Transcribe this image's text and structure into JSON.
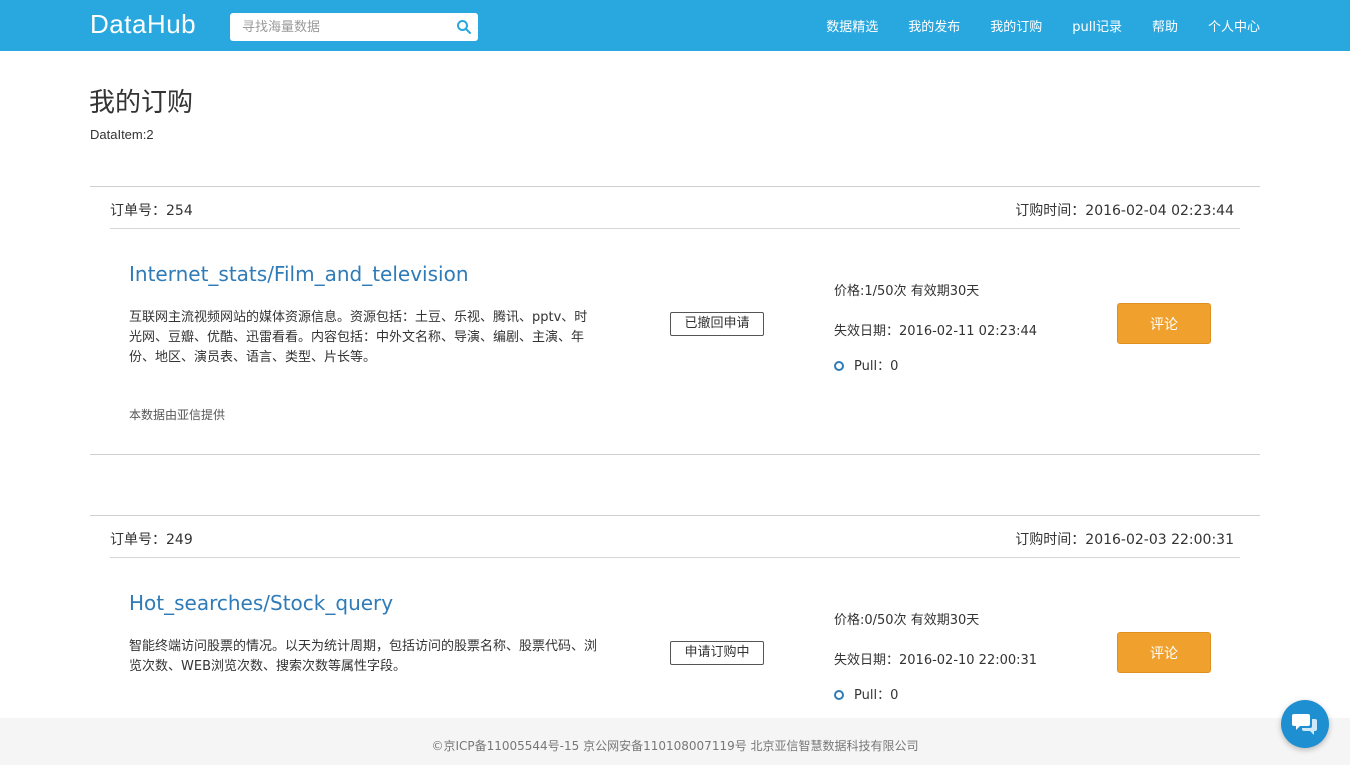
{
  "header": {
    "logo": "DataHub",
    "search_placeholder": "寻找海量数据",
    "nav": [
      "数据精选",
      "我的发布",
      "我的订购",
      "pull记录",
      "帮助",
      "个人中心"
    ]
  },
  "page": {
    "title": "我的订购",
    "item_count": "DataItem:2"
  },
  "orders": [
    {
      "order_no": "订单号：254",
      "order_time": "订购时间：2016-02-04 02:23:44",
      "title": "Internet_stats/Film_and_television",
      "description": "互联网主流视频网站的媒体资源信息。资源包括：土豆、乐视、腾讯、pptv、时光网、豆瓣、优酷、迅雷看看。内容包括：中外文名称、导演、编剧、主演、年份、地区、演员表、语言、类型、片长等。",
      "provider": "本数据由亚信提供",
      "status": "已撤回申请",
      "price": "价格:1/50次 有效期30天",
      "expiry": "失效日期：2016-02-11 02:23:44",
      "pull": "Pull：0",
      "comment_label": "评论"
    },
    {
      "order_no": "订单号：249",
      "order_time": "订购时间：2016-02-03 22:00:31",
      "title": "Hot_searches/Stock_query",
      "description": "智能终端访问股票的情况。以天为统计周期，包括访问的股票名称、股票代码、浏览次数、WEB浏览次数、搜索次数等属性字段。",
      "status": "申请订购中",
      "price": "价格:0/50次 有效期30天",
      "expiry": "失效日期：2016-02-10 22:00:31",
      "pull": "Pull：0",
      "comment_label": "评论"
    }
  ],
  "footer": {
    "text": "©京ICP备11005544号-15 京公网安备110108007119号 北京亚信智慧数据科技有限公司"
  },
  "colors": {
    "header_bg": "#29a8e0",
    "link": "#2f7bb8",
    "comment_button": "#f0a12d",
    "chat_button": "#1e8fd0"
  },
  "icons": [
    "search-icon",
    "chat-icon"
  ]
}
